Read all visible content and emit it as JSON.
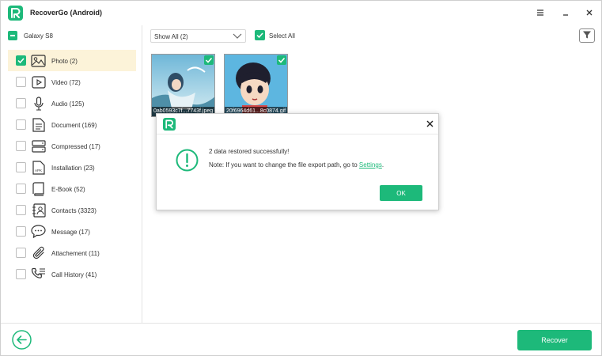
{
  "app": {
    "title": "RecoverGo (Android)",
    "accent_color": "#1db97a"
  },
  "sidebar": {
    "device_label": "Galaxy S8",
    "items": [
      {
        "label": "Photo  (2)",
        "icon": "image-icon",
        "checked": true
      },
      {
        "label": "Video  (72)",
        "icon": "video-icon",
        "checked": false
      },
      {
        "label": "Audio  (125)",
        "icon": "microphone-icon",
        "checked": false
      },
      {
        "label": "Document  (169)",
        "icon": "document-icon",
        "checked": false
      },
      {
        "label": "Compressed  (17)",
        "icon": "archive-icon",
        "checked": false
      },
      {
        "label": "Installation  (23)",
        "icon": "apk-icon",
        "checked": false
      },
      {
        "label": "E-Book  (52)",
        "icon": "book-icon",
        "checked": false
      },
      {
        "label": "Contacts  (3323)",
        "icon": "contacts-icon",
        "checked": false
      },
      {
        "label": "Message  (17)",
        "icon": "message-icon",
        "checked": false
      },
      {
        "label": "Attachement  (11)",
        "icon": "paperclip-icon",
        "checked": false
      },
      {
        "label": "Call History  (41)",
        "icon": "call-history-icon",
        "checked": false
      }
    ]
  },
  "toolbar": {
    "filter_value": "Show All (2)",
    "select_all_label": "Select All"
  },
  "files": [
    {
      "name": "0ab0593c7f...7743f.jpeg",
      "checked": true
    },
    {
      "name": "20f6964d61...8c0874.gif",
      "checked": true
    }
  ],
  "dialog": {
    "message": "2 data restored successfully!",
    "note_prefix": "Note: If you want to change the file export path, go to ",
    "note_link": "Settings",
    "note_suffix": ".",
    "ok_label": "OK"
  },
  "footer": {
    "recover_label": "Recover"
  }
}
